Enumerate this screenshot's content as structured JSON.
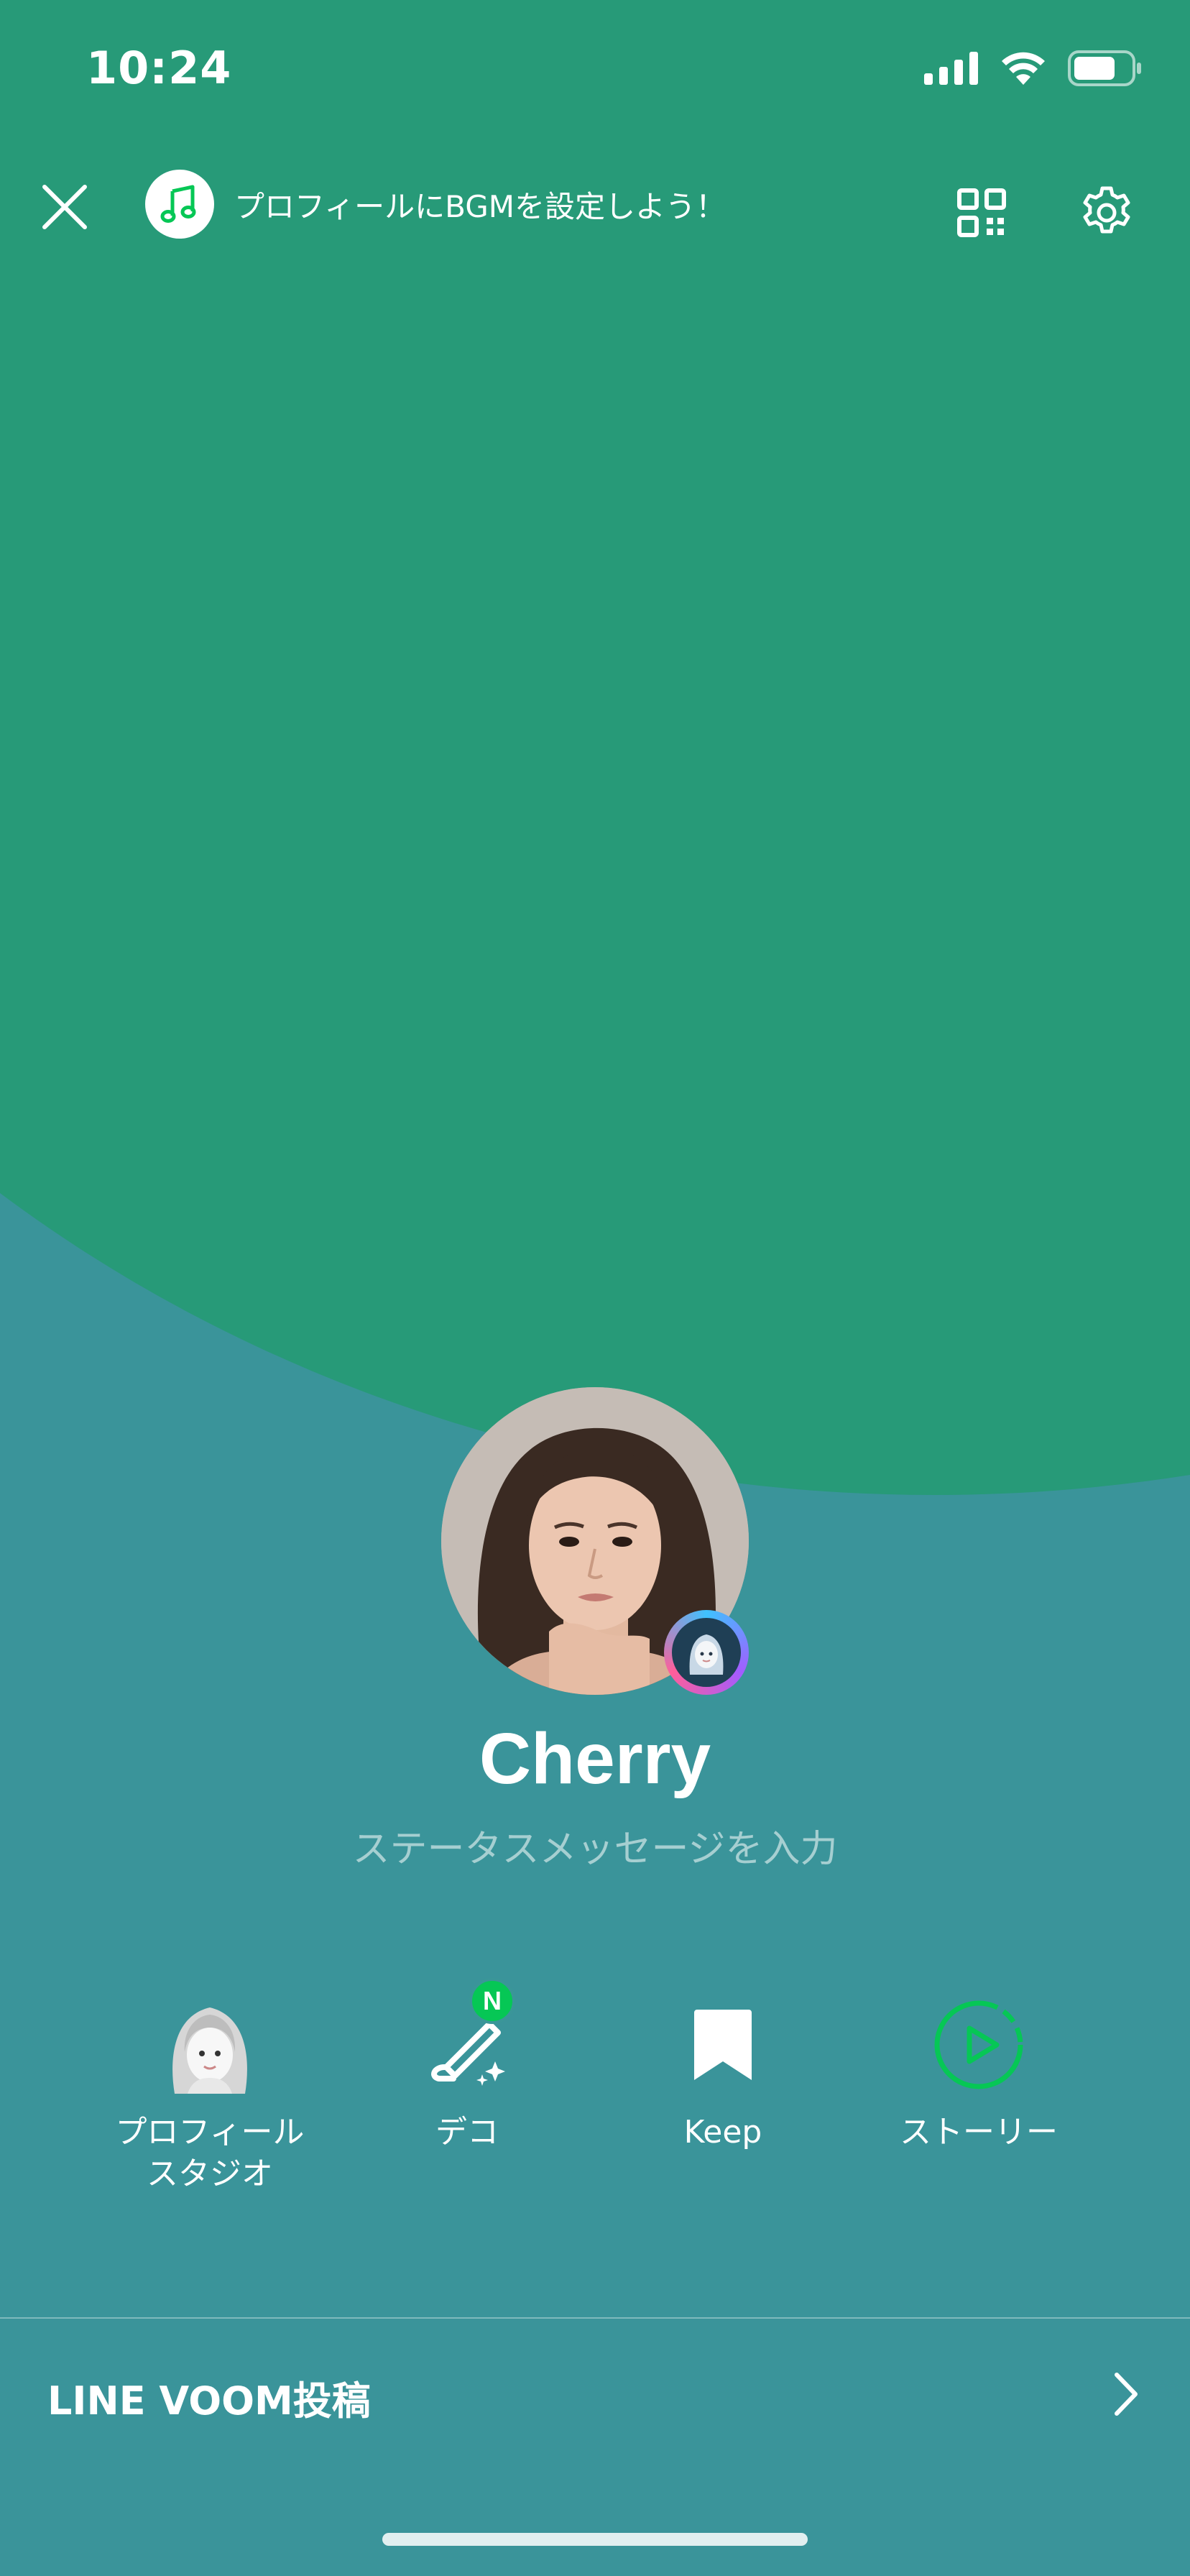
{
  "status_bar": {
    "time": "10:24"
  },
  "top_bar": {
    "bgm_text": "プロフィールにBGMを設定しよう！",
    "icons": [
      "close-icon",
      "music-note-icon",
      "qr-code-icon",
      "gear-icon"
    ]
  },
  "profile": {
    "name": "Cherry",
    "status_placeholder": "ステータスメッセージを入力"
  },
  "actions": [
    {
      "label": "プロフィール\nスタジオ",
      "icon": "avatar-studio-icon"
    },
    {
      "label": "デコ",
      "icon": "deco-wand-icon",
      "badge": "N"
    },
    {
      "label": "Keep",
      "icon": "bookmark-icon"
    },
    {
      "label": "ストーリー",
      "icon": "story-play-icon"
    }
  ],
  "voom": {
    "label": "LINE VOOM投稿"
  },
  "colors": {
    "background_green": "#279a78",
    "background_teal": "#3a949a",
    "accent_green": "#06c755"
  }
}
